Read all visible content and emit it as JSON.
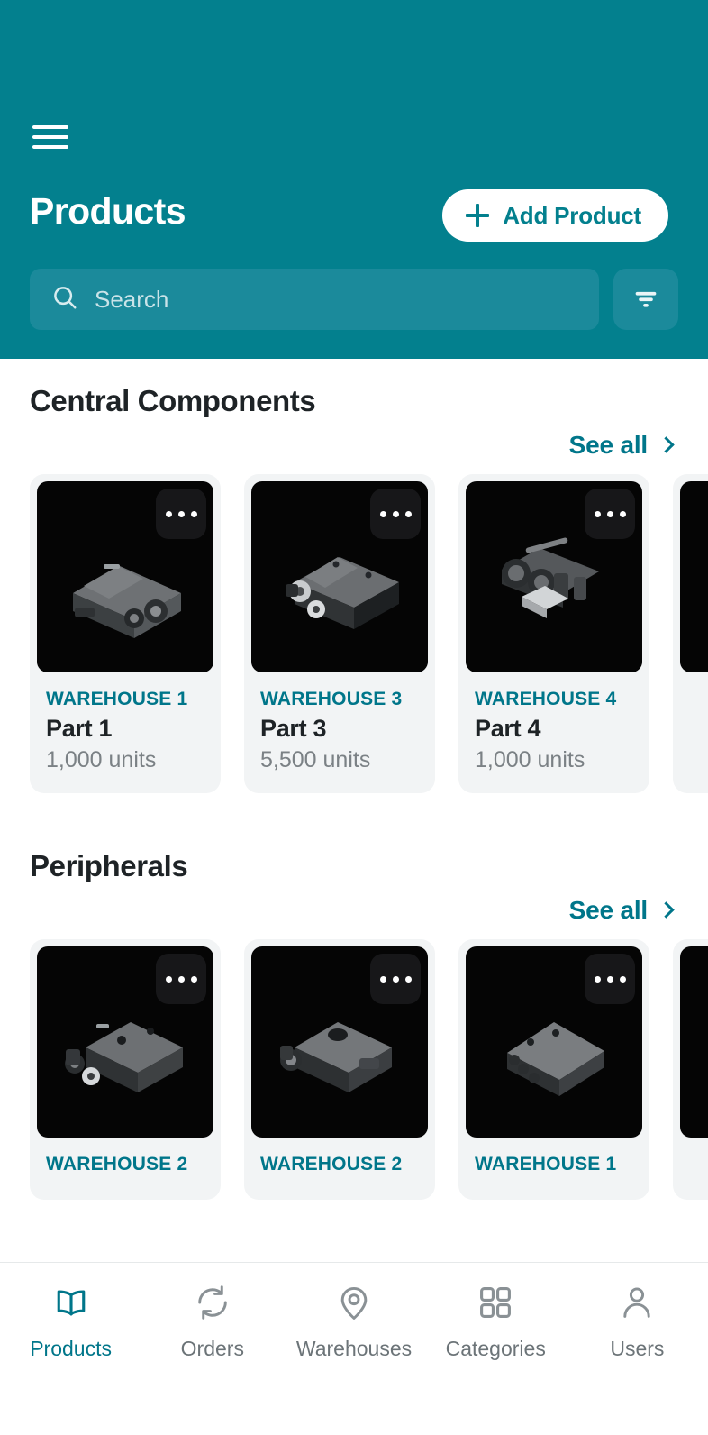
{
  "theme": {
    "header_bg": "#03808E",
    "search_bg": "#1B8A9B",
    "accent": "#00768A",
    "card_bg": "#F2F4F5",
    "thumb_bg": "#050505",
    "text_dark": "#1E2326",
    "text_muted": "#7B8185"
  },
  "header": {
    "menu_icon": "hamburger-menu-icon",
    "title": "Products",
    "add_button": {
      "label": "Add Product",
      "icon": "plus-icon"
    },
    "search": {
      "placeholder": "Search",
      "value": "",
      "icon": "search-icon"
    },
    "filter_button": {
      "icon": "filter-icon",
      "label": ""
    }
  },
  "sections": [
    {
      "title": "Central Components",
      "see_all": {
        "label": "See all",
        "icon": "chevron-right-icon"
      },
      "cards": [
        {
          "warehouse": "WAREHOUSE 1",
          "name": "Part 1",
          "units": "1,000 units",
          "menu_icon": "more-options-icon",
          "image": "part-render-1"
        },
        {
          "warehouse": "WAREHOUSE 3",
          "name": "Part 3",
          "units": "5,500 units",
          "menu_icon": "more-options-icon",
          "image": "part-render-2"
        },
        {
          "warehouse": "WAREHOUSE 4",
          "name": "Part 4",
          "units": "1,000 units",
          "menu_icon": "more-options-icon",
          "image": "part-render-3"
        },
        {
          "warehouse": "",
          "name": "",
          "units": "",
          "menu_icon": "more-options-icon",
          "image": "part-render-4"
        }
      ]
    },
    {
      "title": "Peripherals",
      "see_all": {
        "label": "See all",
        "icon": "chevron-right-icon"
      },
      "cards": [
        {
          "warehouse": "WAREHOUSE 2",
          "name": "",
          "units": "",
          "menu_icon": "more-options-icon",
          "image": "part-render-5"
        },
        {
          "warehouse": "WAREHOUSE 2",
          "name": "",
          "units": "",
          "menu_icon": "more-options-icon",
          "image": "part-render-6"
        },
        {
          "warehouse": "WAREHOUSE 1",
          "name": "",
          "units": "",
          "menu_icon": "more-options-icon",
          "image": "part-render-7"
        },
        {
          "warehouse": "",
          "name": "",
          "units": "",
          "menu_icon": "more-options-icon",
          "image": "part-render-8"
        }
      ]
    }
  ],
  "bottom_nav": {
    "active_index": 0,
    "items": [
      {
        "label": "Products",
        "icon": "book-icon"
      },
      {
        "label": "Orders",
        "icon": "sync-icon"
      },
      {
        "label": "Warehouses",
        "icon": "map-pin-icon"
      },
      {
        "label": "Categories",
        "icon": "grid-icon"
      },
      {
        "label": "Users",
        "icon": "user-icon"
      }
    ]
  }
}
